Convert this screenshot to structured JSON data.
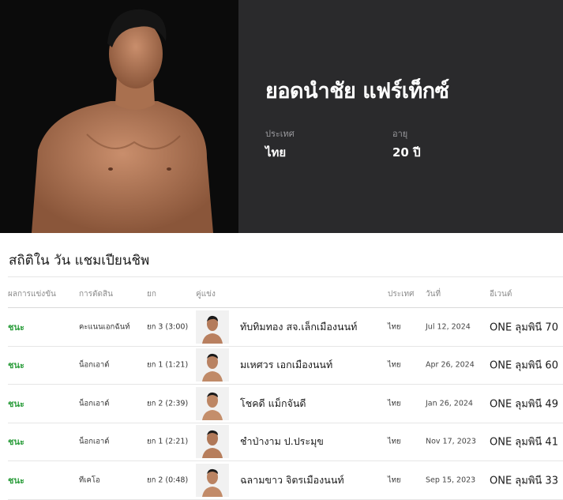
{
  "fighter": {
    "name": "ยอดนำชัย แฟร์เท็กซ์",
    "country_label": "ประเทศ",
    "country": "ไทย",
    "age_label": "อายุ",
    "age": "20 ปี"
  },
  "stats": {
    "title": "สถิติใน วัน แชมเปียนชิพ",
    "headers": {
      "result": "ผลการแข่งขัน",
      "method": "การตัดสิน",
      "round": "ยก",
      "opponent": "คู่แข่ง",
      "country": "ประเทศ",
      "date": "วันที่",
      "event": "อีเวนต์"
    },
    "rows": [
      {
        "result": "ชนะ",
        "method": "คะแนนเอกฉันท์",
        "round": "ยก 3 (3:00)",
        "opponent": "ทับทิมทอง สจ.เล็กเมืองนนท์",
        "country": "ไทย",
        "date": "Jul 12, 2024",
        "event": "ONE ลุมพินี 70"
      },
      {
        "result": "ชนะ",
        "method": "น็อกเอาต์",
        "round": "ยก 1 (1:21)",
        "opponent": "มเหศวร เอกเมืองนนท์",
        "country": "ไทย",
        "date": "Apr 26, 2024",
        "event": "ONE ลุมพินี 60"
      },
      {
        "result": "ชนะ",
        "method": "น็อกเอาต์",
        "round": "ยก 2 (2:39)",
        "opponent": "โชคดี แม็กจันดี",
        "country": "ไทย",
        "date": "Jan 26, 2024",
        "event": "ONE ลุมพินี 49"
      },
      {
        "result": "ชนะ",
        "method": "น็อกเอาต์",
        "round": "ยก 1 (2:21)",
        "opponent": "ชำป่างาม ป.ประมุข",
        "country": "ไทย",
        "date": "Nov 17, 2023",
        "event": "ONE ลุมพินี 41"
      },
      {
        "result": "ชนะ",
        "method": "ทีเคโอ",
        "round": "ยก 2 (0:48)",
        "opponent": "ฉลามขาว จิตรเมืองนนท์",
        "country": "ไทย",
        "date": "Sep 15, 2023",
        "event": "ONE ลุมพินี 33"
      }
    ]
  },
  "colors": {
    "hero_bg": "#2a2a2c",
    "photo_bg": "#0b0b0b",
    "win_green": "#2e9e3e"
  }
}
